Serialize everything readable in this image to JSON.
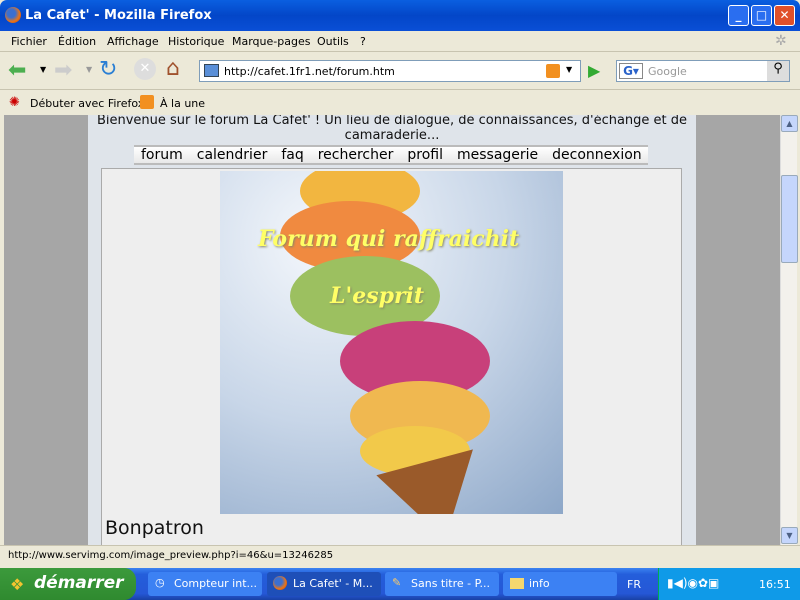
{
  "window": {
    "title": "La Cafet' - Mozilla Firefox"
  },
  "menu": [
    "Fichier",
    "Édition",
    "Affichage",
    "Historique",
    "Marque-pages",
    "Outils",
    "?"
  ],
  "navbar": {
    "url": "http://cafet.1fr1.net/forum.htm",
    "search_placeholder": "Google"
  },
  "bookmarks": [
    "Débuter avec Firefox",
    "À la une"
  ],
  "page": {
    "welcome": "Bienvenue sur le forum La Cafet' ! Un lieu de dialogue, de connaissances, d'échange et de camaraderie...",
    "nav": [
      "forum",
      "calendrier",
      "faq",
      "rechercher",
      "profil",
      "messagerie",
      "deconnexion"
    ],
    "banner_text_1": "Forum qui raffraichit",
    "banner_text_2": "L'esprit",
    "username": "Bonpatron"
  },
  "status": "http://www.servimg.com/image_preview.php?i=46&u=13246285",
  "taskbar": {
    "start": "démarrer",
    "tasks": [
      "Compteur int...",
      "La Cafet' - M...",
      "Sans titre - P...",
      "info"
    ],
    "lang": "FR",
    "clock": "16:51"
  }
}
